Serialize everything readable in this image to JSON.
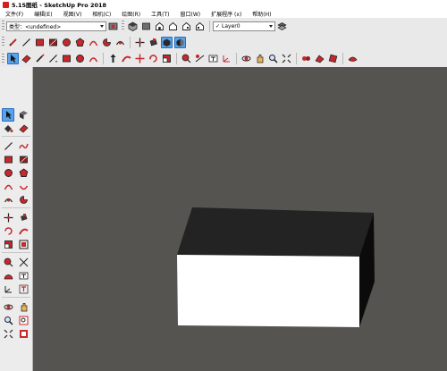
{
  "window": {
    "title": "5.15图纸 - SketchUp Pro 2018"
  },
  "menu": [
    "文件(F)",
    "编辑(E)",
    "视图(V)",
    "相机(C)",
    "绘图(R)",
    "工具(T)",
    "窗口(W)",
    "扩展程序 (x)",
    "帮助(H)"
  ],
  "toolbar": {
    "style_select": "类型：<undefined>",
    "layer_select": "Layer0",
    "layer_check": "✓"
  },
  "icons": {
    "row2": [
      "pencil-icon",
      "line-icon",
      "rectangle-icon",
      "rotated-rectangle-icon",
      "circle-icon",
      "polygon-icon",
      "arc-icon",
      "pie-icon",
      "arc3-icon",
      "move-icon",
      "push-pull-icon",
      "rotate-icon",
      "offset-icon",
      "x-ray-icon",
      "back-edges-icon",
      "wireframe-icon",
      "hidden-line-icon",
      "shaded-icon",
      "shaded-textures-icon",
      "monochrome-icon"
    ],
    "row3": [
      "select-icon",
      "eraser-icon",
      "paint-icon",
      "line-tool-icon",
      "rectangle-tool-icon",
      "circle-tool-icon",
      "arc-tool-icon",
      "push-pull-tool-icon",
      "follow-me-icon",
      "move-tool-icon",
      "rotate-tool-icon",
      "scale-icon",
      "offset-tool-icon",
      "tape-measure-icon",
      "dimension-icon",
      "protractor-icon",
      "text-icon",
      "axes-icon",
      "3d-text-icon",
      "orbit-icon",
      "pan-icon",
      "zoom-icon",
      "zoom-extents-icon",
      "walk-icon",
      "look-around-icon",
      "position-camera-icon",
      "section-plane-icon",
      "warehouse-icon",
      "extension-icon",
      "layout-icon"
    ]
  },
  "colors": {
    "viewport_bg": "#555450",
    "box_top": "#232323",
    "box_front": "#ffffff",
    "box_side": "#0b0b0b",
    "accent_red": "#c6282c",
    "active_blue": "#58a3ea"
  }
}
